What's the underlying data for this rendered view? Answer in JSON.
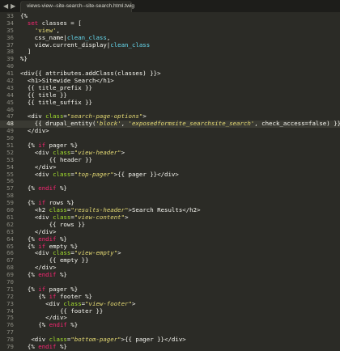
{
  "tab": {
    "title": "views-view--site-search--site-search.html.twig"
  },
  "nav": {
    "back": "◀",
    "forward": "▶"
  },
  "editor": {
    "active_line": 48,
    "lines": [
      {
        "n": "33",
        "tokens": [
          [
            "pl",
            "{%"
          ]
        ]
      },
      {
        "n": "34",
        "tokens": [
          [
            "pl",
            "  "
          ],
          [
            "kw",
            "set"
          ],
          [
            "pl",
            " classes = ["
          ]
        ]
      },
      {
        "n": "35",
        "tokens": [
          [
            "pl",
            "    "
          ],
          [
            "str",
            "'view'"
          ],
          [
            "pl",
            ","
          ]
        ]
      },
      {
        "n": "36",
        "tokens": [
          [
            "pl",
            "    css_name"
          ],
          [
            "op",
            "|"
          ],
          [
            "fil",
            "clean_class"
          ],
          [
            "pl",
            ","
          ]
        ]
      },
      {
        "n": "37",
        "tokens": [
          [
            "pl",
            "    view.current_display"
          ],
          [
            "op",
            "|"
          ],
          [
            "fil",
            "clean_class"
          ]
        ]
      },
      {
        "n": "38",
        "tokens": [
          [
            "pl",
            "  ]"
          ]
        ]
      },
      {
        "n": "39",
        "tokens": [
          [
            "pl",
            "%}"
          ]
        ]
      },
      {
        "n": "40",
        "tokens": []
      },
      {
        "n": "41",
        "tokens": [
          [
            "tag",
            "<div"
          ],
          [
            "pl",
            "{{ attributes.addClass(classes) }}"
          ],
          [
            "tag",
            ">"
          ]
        ]
      },
      {
        "n": "42",
        "tokens": [
          [
            "pl",
            "  "
          ],
          [
            "tag",
            "<h1>"
          ],
          [
            "pl",
            "Sitewide Search"
          ],
          [
            "tag",
            "</h1>"
          ]
        ]
      },
      {
        "n": "43",
        "tokens": [
          [
            "pl",
            "  {{ title_prefix }}"
          ]
        ]
      },
      {
        "n": "44",
        "tokens": [
          [
            "pl",
            "  {{ title }}"
          ]
        ]
      },
      {
        "n": "45",
        "tokens": [
          [
            "pl",
            "  {{ title_suffix }}"
          ]
        ]
      },
      {
        "n": "46",
        "tokens": []
      },
      {
        "n": "47",
        "tokens": [
          [
            "pl",
            "  "
          ],
          [
            "tag",
            "<div "
          ],
          [
            "attr",
            "class"
          ],
          [
            "pl",
            "="
          ],
          [
            "val",
            "\"search-page-options\""
          ],
          [
            "tag",
            ">"
          ]
        ]
      },
      {
        "n": "48",
        "tokens": [
          [
            "pl",
            "    {{ drupal_entity("
          ],
          [
            "val",
            "'block'"
          ],
          [
            "pl",
            ", "
          ],
          [
            "val",
            "'exposedformsite_searchsite_search'"
          ],
          [
            "pl",
            ", check_access=false) }}"
          ]
        ]
      },
      {
        "n": "49",
        "tokens": [
          [
            "pl",
            "  "
          ],
          [
            "tag",
            "</div>"
          ]
        ]
      },
      {
        "n": "50",
        "tokens": []
      },
      {
        "n": "51",
        "tokens": [
          [
            "pl",
            "  {% "
          ],
          [
            "kw",
            "if"
          ],
          [
            "pl",
            " pager %}"
          ]
        ]
      },
      {
        "n": "52",
        "tokens": [
          [
            "pl",
            "    "
          ],
          [
            "tag",
            "<div "
          ],
          [
            "attr",
            "class"
          ],
          [
            "pl",
            "="
          ],
          [
            "val",
            "\"view-header\""
          ],
          [
            "tag",
            ">"
          ]
        ]
      },
      {
        "n": "53",
        "tokens": [
          [
            "pl",
            "        {{ header }}"
          ]
        ]
      },
      {
        "n": "54",
        "tokens": [
          [
            "pl",
            "    "
          ],
          [
            "tag",
            "</div>"
          ]
        ]
      },
      {
        "n": "55",
        "tokens": [
          [
            "pl",
            "    "
          ],
          [
            "tag",
            "<div "
          ],
          [
            "attr",
            "class"
          ],
          [
            "pl",
            "="
          ],
          [
            "val",
            "\"top-pager\""
          ],
          [
            "tag",
            ">"
          ],
          [
            "pl",
            "{{ pager }}"
          ],
          [
            "tag",
            "</div>"
          ]
        ]
      },
      {
        "n": "56",
        "tokens": []
      },
      {
        "n": "57",
        "tokens": [
          [
            "pl",
            "  {% "
          ],
          [
            "kw",
            "endif"
          ],
          [
            "pl",
            " %}"
          ]
        ]
      },
      {
        "n": "58",
        "tokens": []
      },
      {
        "n": "59",
        "tokens": [
          [
            "pl",
            "  {% "
          ],
          [
            "kw",
            "if"
          ],
          [
            "pl",
            " rows %}"
          ]
        ]
      },
      {
        "n": "60",
        "tokens": [
          [
            "pl",
            "    "
          ],
          [
            "tag",
            "<h2 "
          ],
          [
            "attr",
            "class"
          ],
          [
            "pl",
            "="
          ],
          [
            "val",
            "\"results-header\""
          ],
          [
            "tag",
            ">"
          ],
          [
            "pl",
            "Search Results"
          ],
          [
            "tag",
            "</h2>"
          ]
        ]
      },
      {
        "n": "61",
        "tokens": [
          [
            "pl",
            "    "
          ],
          [
            "tag",
            "<div "
          ],
          [
            "attr",
            "class"
          ],
          [
            "pl",
            "="
          ],
          [
            "val",
            "\"view-content\""
          ],
          [
            "tag",
            ">"
          ]
        ]
      },
      {
        "n": "62",
        "tokens": [
          [
            "pl",
            "        {{ rows }}"
          ]
        ]
      },
      {
        "n": "63",
        "tokens": [
          [
            "pl",
            "    "
          ],
          [
            "tag",
            "</div>"
          ]
        ]
      },
      {
        "n": "64",
        "tokens": [
          [
            "pl",
            "  {% "
          ],
          [
            "kw",
            "endif"
          ],
          [
            "pl",
            " %}"
          ]
        ]
      },
      {
        "n": "65",
        "tokens": [
          [
            "pl",
            "  {% "
          ],
          [
            "kw",
            "if"
          ],
          [
            "pl",
            " empty %}"
          ]
        ]
      },
      {
        "n": "66",
        "tokens": [
          [
            "pl",
            "    "
          ],
          [
            "tag",
            "<div "
          ],
          [
            "attr",
            "class"
          ],
          [
            "pl",
            "="
          ],
          [
            "val",
            "\"view-empty\""
          ],
          [
            "tag",
            ">"
          ]
        ]
      },
      {
        "n": "67",
        "tokens": [
          [
            "pl",
            "        {{ empty }}"
          ]
        ]
      },
      {
        "n": "68",
        "tokens": [
          [
            "pl",
            "    "
          ],
          [
            "tag",
            "</div>"
          ]
        ]
      },
      {
        "n": "69",
        "tokens": [
          [
            "pl",
            "  {% "
          ],
          [
            "kw",
            "endif"
          ],
          [
            "pl",
            " %}"
          ]
        ]
      },
      {
        "n": "70",
        "tokens": []
      },
      {
        "n": "71",
        "tokens": [
          [
            "pl",
            "  {% "
          ],
          [
            "kw",
            "if"
          ],
          [
            "pl",
            " pager %}"
          ]
        ]
      },
      {
        "n": "72",
        "tokens": [
          [
            "pl",
            "     {% "
          ],
          [
            "kw",
            "if"
          ],
          [
            "pl",
            " footer %}"
          ]
        ]
      },
      {
        "n": "73",
        "tokens": [
          [
            "pl",
            "       "
          ],
          [
            "tag",
            "<div "
          ],
          [
            "attr",
            "class"
          ],
          [
            "pl",
            "="
          ],
          [
            "val",
            "\"view-footer\""
          ],
          [
            "tag",
            ">"
          ]
        ]
      },
      {
        "n": "74",
        "tokens": [
          [
            "pl",
            "           {{ footer }}"
          ]
        ]
      },
      {
        "n": "75",
        "tokens": [
          [
            "pl",
            "       "
          ],
          [
            "tag",
            "</div>"
          ]
        ]
      },
      {
        "n": "76",
        "tokens": [
          [
            "pl",
            "     {% "
          ],
          [
            "kw",
            "endif"
          ],
          [
            "pl",
            " %}"
          ]
        ]
      },
      {
        "n": "77",
        "tokens": []
      },
      {
        "n": "78",
        "tokens": [
          [
            "pl",
            "   "
          ],
          [
            "tag",
            "<div "
          ],
          [
            "attr",
            "class"
          ],
          [
            "pl",
            "="
          ],
          [
            "val",
            "\"bottom-pager\""
          ],
          [
            "tag",
            ">"
          ],
          [
            "pl",
            "{{ pager }}"
          ],
          [
            "tag",
            "</div>"
          ]
        ]
      },
      {
        "n": "79",
        "tokens": [
          [
            "pl",
            "  {% "
          ],
          [
            "kw",
            "endif"
          ],
          [
            "pl",
            " %}"
          ]
        ]
      },
      {
        "n": "80",
        "tokens": []
      },
      {
        "n": "81",
        "tokens": [
          [
            "tag",
            "</div>"
          ]
        ]
      }
    ]
  }
}
